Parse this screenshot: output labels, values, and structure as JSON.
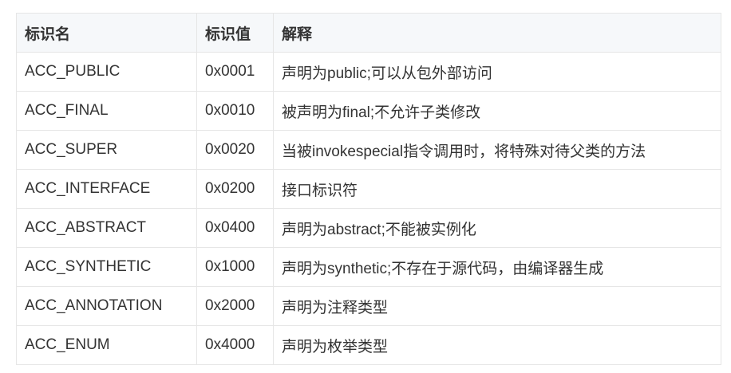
{
  "table": {
    "headers": [
      "标识名",
      "标识值",
      "解释"
    ],
    "rows": [
      [
        "ACC_PUBLIC",
        "0x0001",
        "声明为public;可以从包外部访问"
      ],
      [
        "ACC_FINAL",
        "0x0010",
        "被声明为final;不允许子类修改"
      ],
      [
        "ACC_SUPER",
        "0x0020",
        "当被invokespecial指令调用时，将特殊对待父类的方法"
      ],
      [
        "ACC_INTERFACE",
        "0x0200",
        "接口标识符"
      ],
      [
        "ACC_ABSTRACT",
        "0x0400",
        "声明为abstract;不能被实例化"
      ],
      [
        "ACC_SYNTHETIC",
        "0x1000",
        "声明为synthetic;不存在于源代码，由编译器生成"
      ],
      [
        "ACC_ANNOTATION",
        "0x2000",
        "声明为注释类型"
      ],
      [
        "ACC_ENUM",
        "0x4000",
        "声明为枚举类型"
      ]
    ]
  }
}
